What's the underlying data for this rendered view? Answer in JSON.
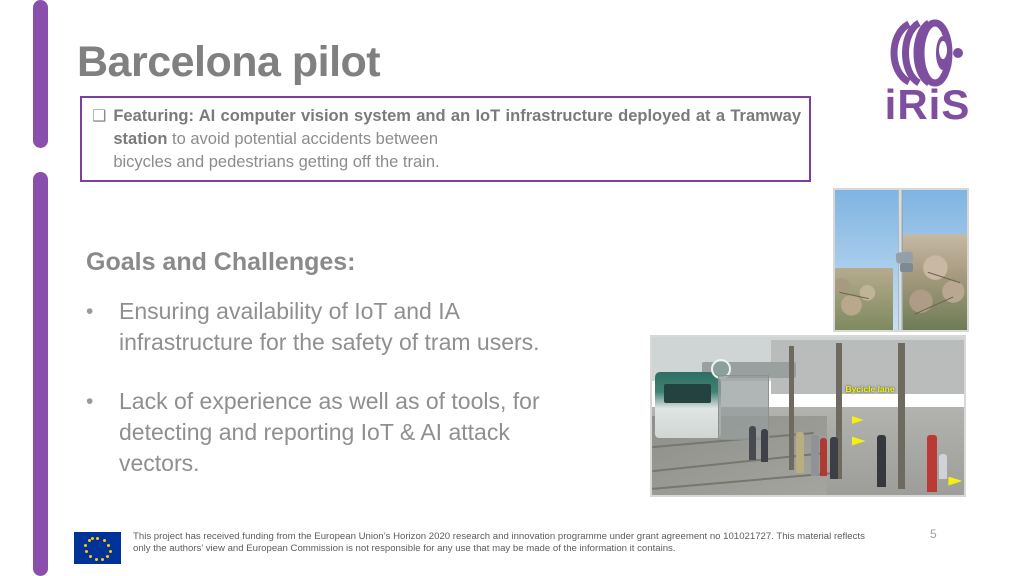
{
  "slide": {
    "title": "Barcelona pilot",
    "number": "5",
    "accent_color": "#8a4fad",
    "title_color": "#808080"
  },
  "featuring": {
    "bullet_glyph": "❑",
    "bold_lead": "Featuring: AI computer vision system and an IoT infrastructure deployed at a Tramway station",
    "rest": " to avoid potential accidents between",
    "tail": "bicycles and pedestrians getting off the train.",
    "border_color": "#7d3f9e"
  },
  "goals": {
    "heading": "Goals and Challenges:",
    "bullet_glyph": "•",
    "items": [
      "Ensuring availability of IoT and IA infrastructure for the safety of tram users.",
      "Lack of experience as well as of tools, for detecting and reporting IoT & AI attack vectors."
    ]
  },
  "images": {
    "pole": {
      "name": "camera-pole-photo",
      "caption": "Pole with camera sensor against blue sky and trees"
    },
    "tram": {
      "name": "tram-station-photo",
      "caption": "Tram station platform with waiting passengers",
      "annotation": "Bycicle lane",
      "annotation_color": "#f2f20d"
    }
  },
  "logo": {
    "wordmark": "iRiS",
    "color": "#7d4f9e",
    "mark": "iris-arcs"
  },
  "footer": {
    "flag": "eu-flag",
    "text": "This project has received funding from the European Union’s Horizon 2020 research and innovation programme under grant agreement no 101021727. This material reflects only the authors’ view and European Commission is not responsible for any use that may be made of the information it contains."
  }
}
